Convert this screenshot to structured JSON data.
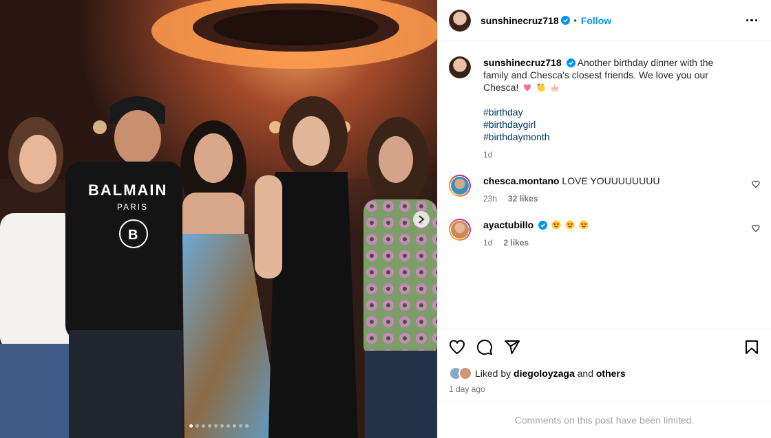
{
  "post": {
    "author": "sunshinecruz718",
    "follow_label": "Follow",
    "separator": "•",
    "caption": "Another birthday dinner with the family and Chesca's closest friends. We love you our Chesca!",
    "hashtags": [
      "#birthday",
      "#birthdaygirl",
      "#birthdaymonth"
    ],
    "posted": "1d",
    "photo_count": 10,
    "active_photo": 1
  },
  "comments": [
    {
      "user": "chesca.montano",
      "text": "LOVE YOUUUUUUUU",
      "time": "23h",
      "likes": "32 likes",
      "verified": false
    },
    {
      "user": "ayactubillo",
      "text": "",
      "time": "1d",
      "likes": "2 likes",
      "verified": true
    }
  ],
  "likes": {
    "prefix": "Liked by",
    "user": "diegoloyzaga",
    "joiner": "and",
    "others": "others",
    "date": "1 day ago"
  },
  "footer": {
    "limited": "Comments on this post have been limited."
  },
  "colors": {
    "accent": "#0095f6",
    "verified": "#0095f6",
    "hashtag": "#00376b",
    "heart": "#ed4956"
  },
  "icons": [
    "verified-icon",
    "more-icon",
    "heart-icon",
    "comment-icon",
    "share-icon",
    "bookmark-icon",
    "chevron-right-icon",
    "heart-eyes-emoji",
    "pink-heart-emoji",
    "party-emoji",
    "cake-emoji"
  ]
}
